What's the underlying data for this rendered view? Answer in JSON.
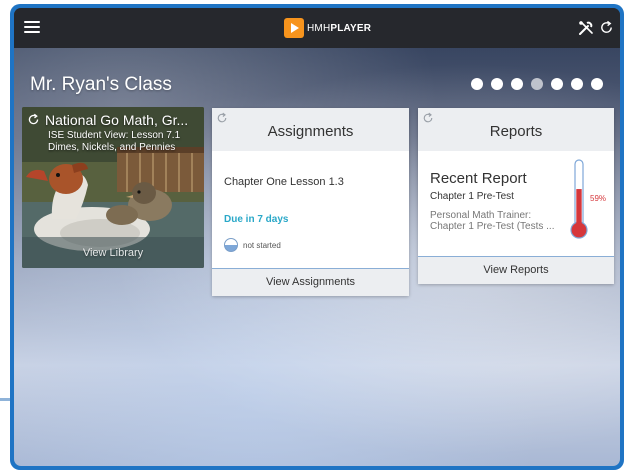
{
  "header": {
    "brand_prefix": "HMH",
    "brand_name": "PLAYER",
    "icons": {
      "menu": "hamburger-menu-icon",
      "logo": "play-triangle-logo",
      "tools": "tools-icon",
      "refresh": "refresh-icon"
    }
  },
  "class_title": "Mr. Ryan's Class",
  "page_dots": {
    "count": 7,
    "active_index": 3
  },
  "library": {
    "title": "National Go Math, Gr...",
    "subtitle_lines": [
      "ISE Student View: Lesson 7.1",
      "Dimes, Nickels, and Pennies"
    ],
    "link_label": "View Library"
  },
  "assignments": {
    "title": "Assignments",
    "lesson": "Chapter One Lesson 1.3",
    "due": "Due in 7 days",
    "status": "not started",
    "footer_label": "View Assignments"
  },
  "reports": {
    "title": "Reports",
    "heading": "Recent Report",
    "test_name": "Chapter 1 Pre-Test",
    "detail_lines": [
      "Personal Math Trainer:",
      "Chapter 1 Pre-Test (Tests ..."
    ],
    "score_percent": 59,
    "score_label": "59%",
    "footer_label": "View Reports"
  },
  "colors": {
    "frame": "#1f74c4",
    "topbar": "#26282d",
    "logo": "#f7941d",
    "due": "#2aa8c8",
    "thermometer": "#d6373b",
    "footer_rule": "#8aaed6"
  }
}
